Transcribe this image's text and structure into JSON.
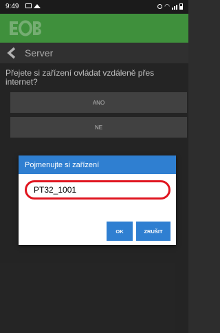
{
  "status_bar": {
    "time": "9:49",
    "left_icons": [
      "image-icon",
      "triangle-notification-icon"
    ],
    "right_icons": [
      "alarm-icon",
      "wifi-icon",
      "signal-icon",
      "battery-icon"
    ]
  },
  "app_header": {
    "logo_icon": "eob-logo-icon",
    "color": "#4db04a"
  },
  "toolbar": {
    "back_icon": "chevron-left-icon",
    "title": "Server"
  },
  "content": {
    "question": "Přejete si zařízení ovládat vzdáleně přes internet?",
    "yes_label": "ANO",
    "no_label": "NE"
  },
  "dialog": {
    "title": "Pojmenujte si zařízení",
    "input_value": "PT32_1001",
    "ok_label": "OK",
    "cancel_label": "ZRUŠIT",
    "accent_color": "#2f7fd1",
    "highlight_color": "#e0151f"
  }
}
